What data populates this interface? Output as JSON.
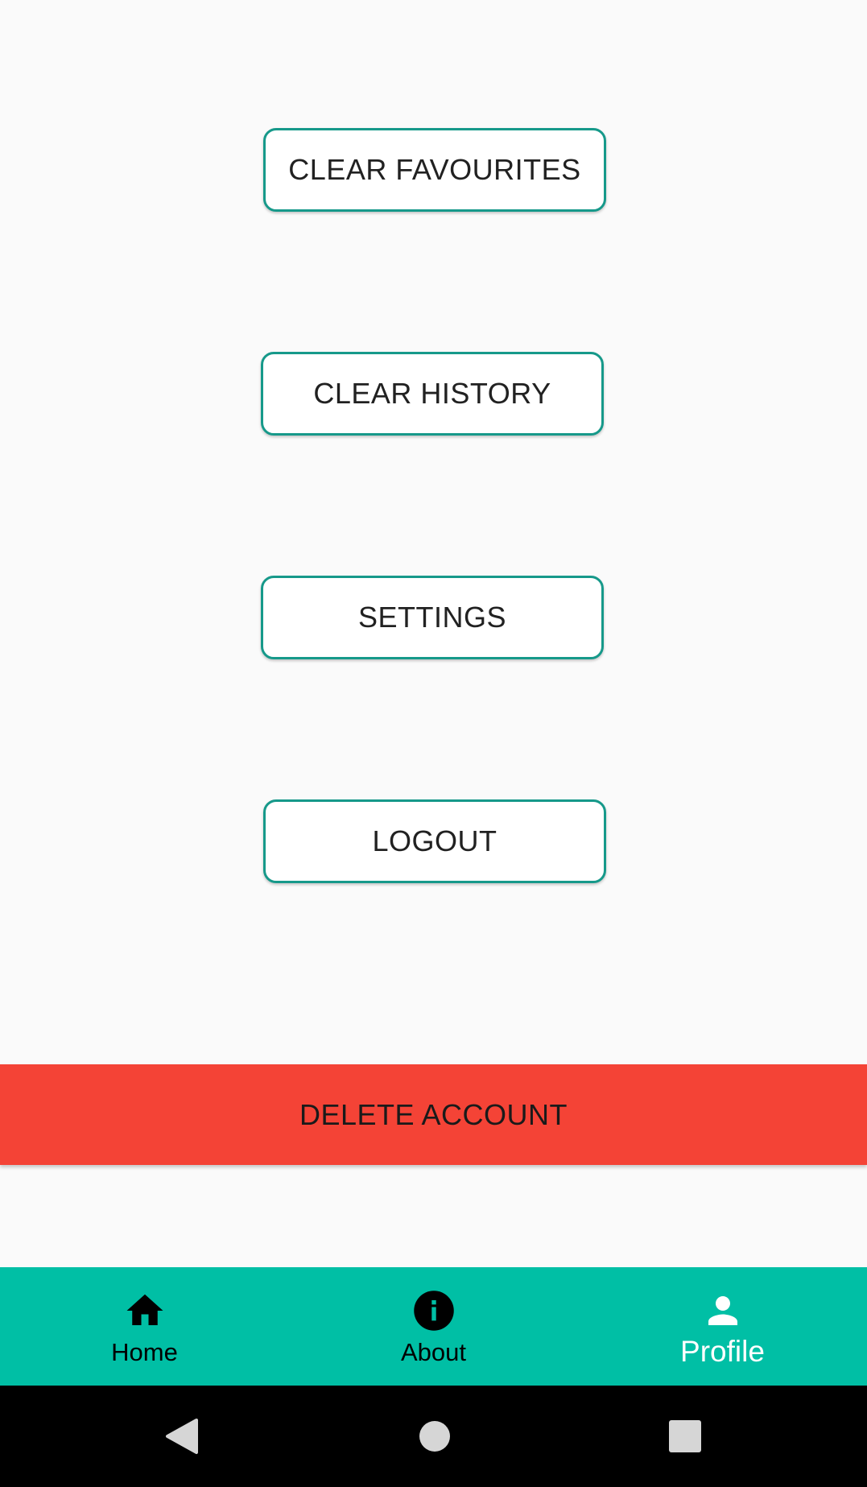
{
  "buttons": {
    "clear_favourites": "CLEAR FAVOURITES",
    "clear_history": "CLEAR HISTORY",
    "settings": "SETTINGS",
    "logout": "LOGOUT",
    "delete_account": "DELETE ACCOUNT"
  },
  "bottom_nav": {
    "items": [
      {
        "label": "Home",
        "icon": "home-icon",
        "active": false
      },
      {
        "label": "About",
        "icon": "info-icon",
        "active": false
      },
      {
        "label": "Profile",
        "icon": "person-icon",
        "active": true
      }
    ]
  },
  "system_nav": {
    "back": "back-icon",
    "home": "home-circle-icon",
    "recents": "recents-icon"
  },
  "colors": {
    "accent": "#00bfa5",
    "outline": "#16998a",
    "danger": "#f44336",
    "background": "#fafafa"
  }
}
